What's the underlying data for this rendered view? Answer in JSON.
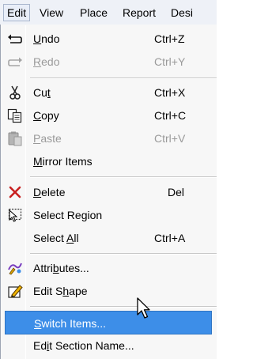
{
  "menubar": {
    "items": [
      "Edit",
      "View",
      "Place",
      "Report",
      "Desi"
    ],
    "active": "Edit"
  },
  "menu": {
    "undo": {
      "pre": "",
      "mn": "U",
      "post": "ndo",
      "shortcut": "Ctrl+Z",
      "icon": "undo-arrow-icon"
    },
    "redo": {
      "pre": "",
      "mn": "R",
      "post": "edo",
      "shortcut": "Ctrl+Y",
      "icon": "redo-arrow-icon",
      "disabled": true
    },
    "cut": {
      "pre": "Cu",
      "mn": "t",
      "post": "",
      "shortcut": "Ctrl+X",
      "icon": "scissors-icon"
    },
    "copy": {
      "pre": "",
      "mn": "C",
      "post": "opy",
      "shortcut": "Ctrl+C",
      "icon": "copy-icon"
    },
    "paste": {
      "pre": "",
      "mn": "P",
      "post": "aste",
      "shortcut": "Ctrl+V",
      "icon": "clipboard-icon",
      "disabled": true
    },
    "mirror": {
      "pre": "",
      "mn": "M",
      "post": "irror Items"
    },
    "delete": {
      "pre": "",
      "mn": "D",
      "post": "elete",
      "shortcut": "Del",
      "icon": "delete-x-icon"
    },
    "select_region": {
      "text": "Select Region",
      "icon": "select-region-icon"
    },
    "select_all": {
      "pre": "Select ",
      "mn": "A",
      "post": "ll",
      "shortcut": "Ctrl+A"
    },
    "attributes": {
      "pre": "Attri",
      "mn": "b",
      "post": "utes...",
      "icon": "attributes-icon"
    },
    "edit_shape": {
      "pre": "Edit S",
      "mn": "h",
      "post": "ape",
      "icon": "edit-shape-icon"
    },
    "switch_items": {
      "pre": "",
      "mn": "S",
      "post": "witch Items...",
      "highlighted": true
    },
    "edit_section": {
      "pre": "Ed",
      "mn": "i",
      "post": "t Section Name..."
    }
  },
  "colors": {
    "highlight": "#3d8ee8",
    "menubar": "#eef1f7",
    "menu_bg": "#f7f7f7",
    "disabled_text": "#9a9a9a"
  }
}
